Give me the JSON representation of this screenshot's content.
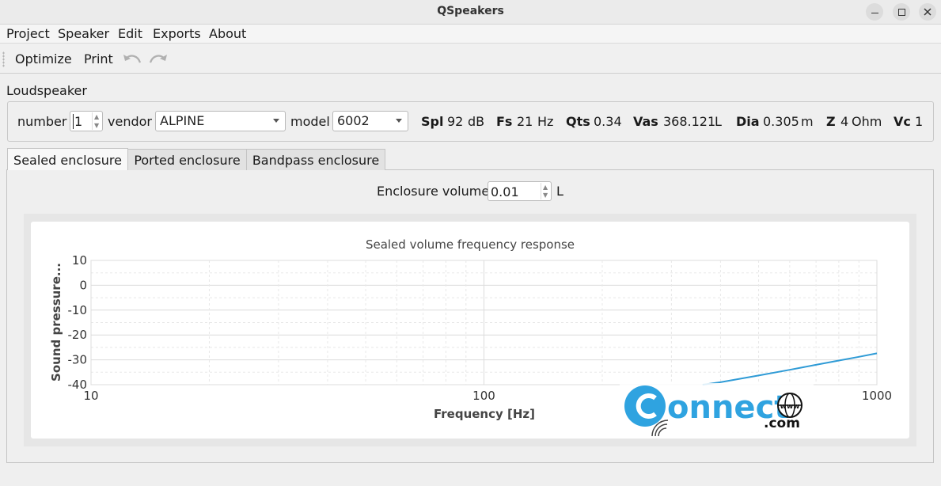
{
  "window": {
    "title": "QSpeakers"
  },
  "menu": [
    "Project",
    "Speaker",
    "Edit",
    "Exports",
    "About"
  ],
  "toolbar": {
    "optimize": "Optimize",
    "print": "Print"
  },
  "loudspeaker": {
    "section_label": "Loudspeaker",
    "number_label": "number",
    "number_value": "1",
    "vendor_label": "vendor",
    "vendor_value": "ALPINE",
    "model_label": "model",
    "model_value": "6002",
    "params": [
      {
        "name": "Spl",
        "value": "92",
        "unit": "dB"
      },
      {
        "name": "Fs",
        "value": "21",
        "unit": "Hz"
      },
      {
        "name": "Qts",
        "value": "0.34",
        "unit": ""
      },
      {
        "name": "Vas",
        "value": "368.121",
        "unit": "L"
      },
      {
        "name": "Dia",
        "value": "0.305",
        "unit": "m"
      },
      {
        "name": "Z",
        "value": "4",
        "unit": "Ohm"
      },
      {
        "name": "Vc",
        "value": "1",
        "unit": ""
      }
    ]
  },
  "tabs": [
    "Sealed enclosure",
    "Ported enclosure",
    "Bandpass enclosure"
  ],
  "enclosure": {
    "label": "Enclosure volume",
    "value": "0.01",
    "unit": "L"
  },
  "watermark": {
    "text_main": "connect",
    "text_sub": ".com",
    "globe_text": "www"
  },
  "chart_data": {
    "type": "line",
    "title": "Sealed volume frequency response",
    "xlabel": "Frequency [Hz]",
    "ylabel": "Sound pressure...",
    "x_scale": "log",
    "xlim": [
      10,
      1000
    ],
    "ylim": [
      -40,
      10
    ],
    "x_ticks": [
      "10",
      "100",
      "1000"
    ],
    "y_ticks": [
      "10",
      "0",
      "-10",
      "-20",
      "-30",
      "-40"
    ],
    "grid": true,
    "series": [
      {
        "color": "#2f9bd6",
        "x": [
          360,
          400,
          500,
          600,
          700,
          800,
          900,
          1000
        ],
        "y": [
          -40.0,
          -39.0,
          -36.3,
          -34.0,
          -32.0,
          -30.3,
          -28.8,
          -27.4
        ]
      }
    ]
  }
}
